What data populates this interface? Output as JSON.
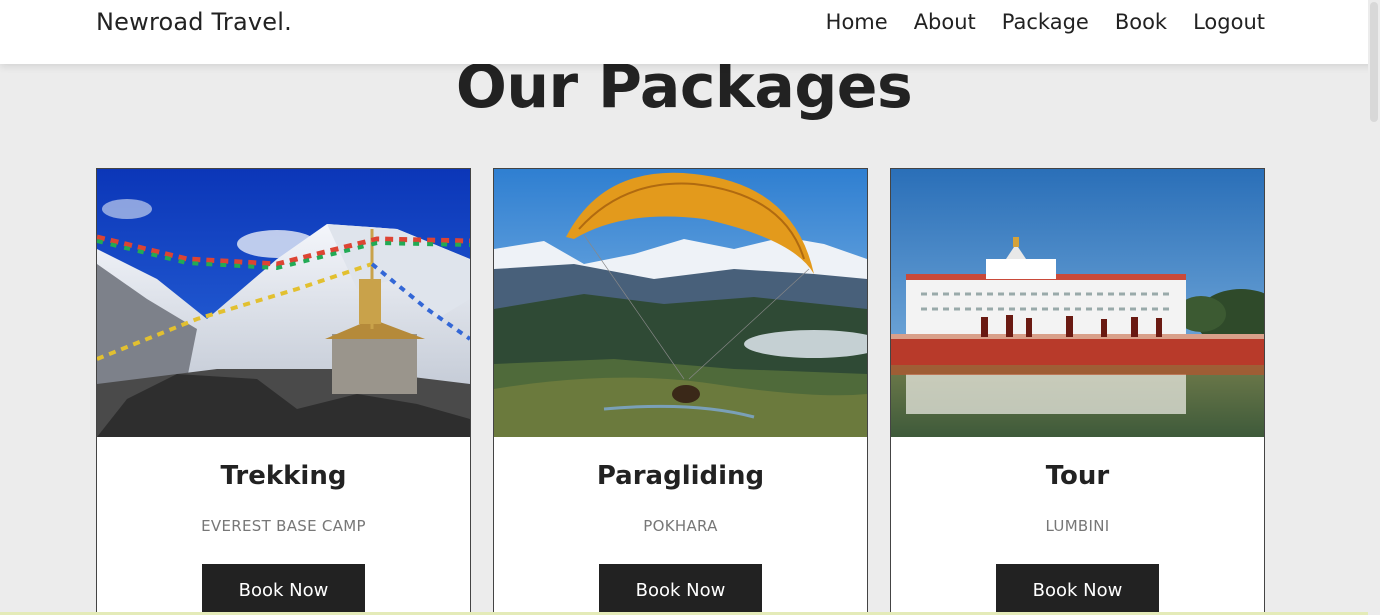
{
  "nav": {
    "brand": "Newroad Travel.",
    "links": [
      "Home",
      "About",
      "Package",
      "Book",
      "Logout"
    ]
  },
  "main": {
    "title": "Our Packages",
    "packages": [
      {
        "title": "Trekking",
        "location": "EVEREST BASE CAMP",
        "button": "Book Now",
        "image": "everest-prayer-flags-photo"
      },
      {
        "title": "Paragliding",
        "location": "POKHARA",
        "button": "Book Now",
        "image": "paraglider-over-valley-photo"
      },
      {
        "title": "Tour",
        "location": "LUMBINI",
        "button": "Book Now",
        "image": "lumbini-temple-reflection-photo"
      }
    ]
  },
  "colors": {
    "background": "#ececec",
    "navbar": "#ffffff",
    "button": "#222222",
    "text": "#222222"
  }
}
